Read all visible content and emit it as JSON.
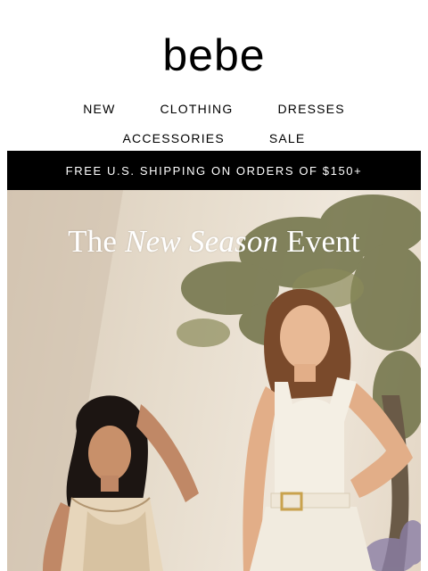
{
  "header": {
    "logo": "bebe"
  },
  "nav": {
    "row1": [
      "NEW",
      "CLOTHING",
      "DRESSES"
    ],
    "row2": [
      "ACCESSORIES",
      "SALE"
    ]
  },
  "banner": {
    "text": "FREE U.S. SHIPPING ON ORDERS OF $150+"
  },
  "hero": {
    "title_part1": "The ",
    "title_italic": "New Season",
    "title_part2": " Event"
  },
  "colors": {
    "banner_bg": "#000000",
    "banner_text": "#ffffff",
    "text": "#000000"
  }
}
